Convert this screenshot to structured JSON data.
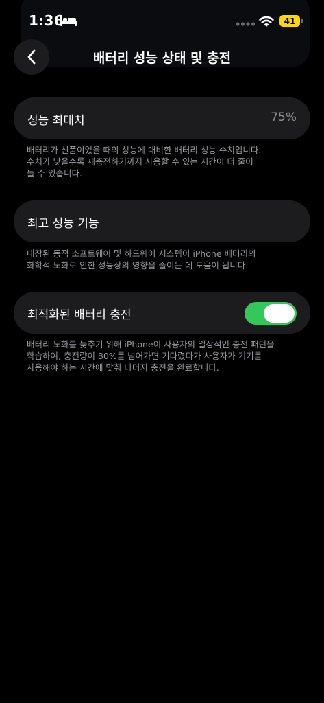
{
  "status_bar": {
    "time": "1:36",
    "battery_level": "41",
    "icons": [
      "bed-icon",
      "cellular-dots-icon",
      "wifi-icon",
      "battery-icon"
    ]
  },
  "nav": {
    "back_icon": "chevron-left-icon",
    "title": "배터리 성능 상태 및 충전"
  },
  "sections": {
    "max_capacity": {
      "label": "성능 최대치",
      "value": "75%",
      "footnote_lines": [
        "배터리가 신품이었을 때의 성능에 대비한 배터리 성능 수치입니다.",
        "수치가 낮을수록 재충전하기까지 사용할 수 있는 시간이 더 줄어",
        "들 수 있습니다."
      ]
    },
    "peak_performance": {
      "label": "최고 성능 기능",
      "footnote_lines": [
        "내장된 동적 소프트웨어 및 하드웨어 시스템이 iPhone 배터리의",
        "화학적 노화로 인한 성능상의 영향을 줄이는 데 도움이 됩니다."
      ]
    },
    "optimized_charging": {
      "label": "최적화된 배터리 충전",
      "toggle_on": true,
      "footnote_lines": [
        "배터리 노화를 늦추기 위해 iPhone이 사용자의 일상적인 충전 패턴을",
        "학습하여, 충전량이 80%를 넘어가면 기다렸다가 사용자가 기기를",
        "사용해야 하는 시간에 맞춰 나머지 충전을 완료합니다."
      ]
    }
  },
  "colors": {
    "background": "#000000",
    "card": "#1c1c1e",
    "secondary_text": "#98989f",
    "toggle_on": "#34c759",
    "battery": "#ffd60a"
  }
}
